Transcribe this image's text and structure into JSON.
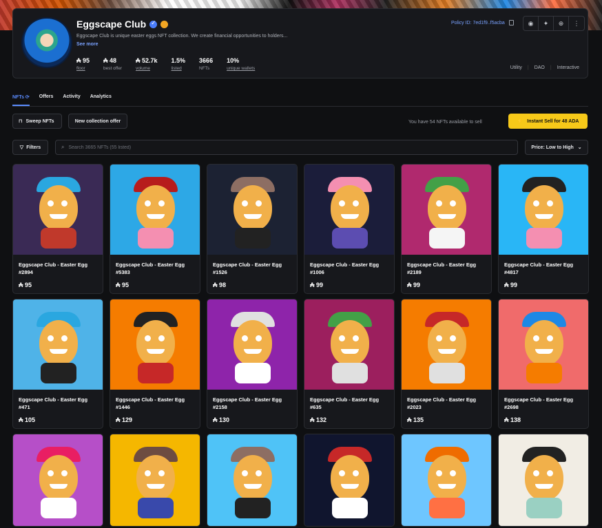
{
  "collection": {
    "name": "Eggscape Club",
    "description": "Eggscape Club is unique easter eggs NFT collection. We create financial opportunities to holders...",
    "see_more": "See more",
    "policy_id": "Policy ID: 7ed1f9..f5acba",
    "stats": [
      {
        "value": "₳ 95",
        "label": "floor"
      },
      {
        "value": "₳ 48",
        "label": "best offer"
      },
      {
        "value": "₳ 52.7k",
        "label": "volume"
      },
      {
        "value": "1.5%",
        "label": "listed"
      },
      {
        "value": "3666",
        "label": "NFTs"
      },
      {
        "value": "10%",
        "label": "unique wallets"
      }
    ],
    "tags": [
      "Utility",
      "DAO",
      "Interactive"
    ]
  },
  "tabs": [
    {
      "label": "NFTs ⟳"
    },
    {
      "label": "Offers"
    },
    {
      "label": "Activity"
    },
    {
      "label": "Analytics"
    }
  ],
  "actions": {
    "sweep": "Sweep NFTs",
    "collection_offer": "New collection offer",
    "available_text": "You have 54 NFTs available to sell",
    "instant_sell": "Instant Sell for 48 ADA"
  },
  "filter_bar": {
    "filters_label": "Filters",
    "search_placeholder": "Search 3665 NFTs (55 listed)",
    "sort_label": "Price: Low to High"
  },
  "items": [
    {
      "name": "Eggscape Club - Easter Egg",
      "id": "#2894",
      "price": "₳ 95",
      "bg": "#3a2a55",
      "hat": "#2aa7e0",
      "body": "#c0392b"
    },
    {
      "name": "Eggscape Club - Easter Egg",
      "id": "#5383",
      "price": "₳ 95",
      "bg": "#2da8e6",
      "hat": "#b71c1c",
      "body": "#f48fb1"
    },
    {
      "name": "Eggscape Club - Easter Egg",
      "id": "#1526",
      "price": "₳ 98",
      "bg": "#1c2233",
      "hat": "#8d6e63",
      "body": "#222222"
    },
    {
      "name": "Eggscape Club - Easter Egg",
      "id": "#1006",
      "price": "₳ 99",
      "bg": "#1b1d3a",
      "hat": "#f48fb1",
      "body": "#5c4db1"
    },
    {
      "name": "Eggscape Club - Easter Egg",
      "id": "#2189",
      "price": "₳ 99",
      "bg": "#b0296e",
      "hat": "#43a047",
      "body": "#f5f5f5"
    },
    {
      "name": "Eggscape Club - Easter Egg",
      "id": "#4817",
      "price": "₳ 99",
      "bg": "#29b6f6",
      "hat": "#222222",
      "body": "#f48fb1"
    },
    {
      "name": "Eggscape Club - Easter Egg",
      "id": "#471",
      "price": "₳ 105",
      "bg": "#4fb3e8",
      "hat": "#2aa7e0",
      "body": "#222222"
    },
    {
      "name": "Eggscape Club - Easter Egg",
      "id": "#1446",
      "price": "₳ 129",
      "bg": "#f57c00",
      "hat": "#222222",
      "body": "#c62828"
    },
    {
      "name": "Eggscape Club - Easter Egg",
      "id": "#2158",
      "price": "₳ 130",
      "bg": "#8e24aa",
      "hat": "#e0e0e0",
      "body": "#ffffff"
    },
    {
      "name": "Eggscape Club - Easter Egg",
      "id": "#635",
      "price": "₳ 132",
      "bg": "#9c1f5e",
      "hat": "#43a047",
      "body": "#e0e0e0"
    },
    {
      "name": "Eggscape Club - Easter Egg",
      "id": "#2023",
      "price": "₳ 135",
      "bg": "#f57c00",
      "hat": "#c62828",
      "body": "#e0e0e0"
    },
    {
      "name": "Eggscape Club - Easter Egg",
      "id": "#2698",
      "price": "₳ 138",
      "bg": "#f06b6b",
      "hat": "#1e88e5",
      "body": "#f57c00"
    },
    {
      "name": "",
      "id": "",
      "price": "",
      "bg": "#b64fc8",
      "hat": "#e91e63",
      "body": "#ffffff"
    },
    {
      "name": "",
      "id": "",
      "price": "",
      "bg": "#f5b700",
      "hat": "#6d4c41",
      "body": "#3949ab"
    },
    {
      "name": "",
      "id": "",
      "price": "",
      "bg": "#4fc3f7",
      "hat": "#8d6e63",
      "body": "#222222"
    },
    {
      "name": "",
      "id": "",
      "price": "",
      "bg": "#10152e",
      "hat": "#c62828",
      "body": "#ffffff"
    },
    {
      "name": "",
      "id": "",
      "price": "",
      "bg": "#6ec6ff",
      "hat": "#ef6c00",
      "body": "#ff7043"
    },
    {
      "name": "",
      "id": "",
      "price": "",
      "bg": "#f1ede4",
      "hat": "#222222",
      "body": "#9ad0c2"
    }
  ],
  "colors": {
    "accent": "#5b8cff",
    "instant_sell": "#f7c919",
    "background": "#0f1012",
    "card": "#17181c"
  }
}
